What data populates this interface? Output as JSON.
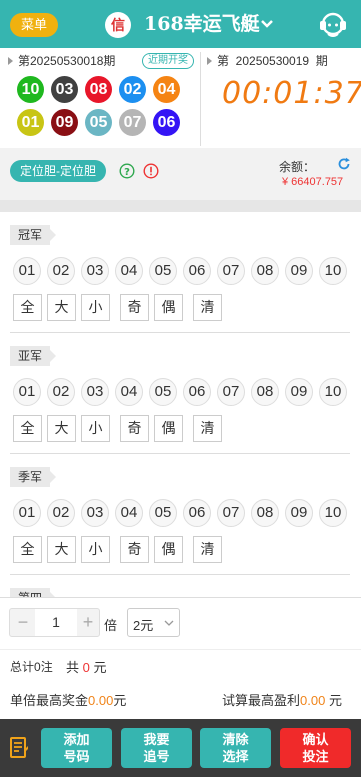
{
  "header": {
    "menu_label": "菜单",
    "badge_label": "信",
    "title": "168幸运飞艇"
  },
  "previous_draw": {
    "issue_label": "第20250530018期",
    "history_label": "近期开奖",
    "balls": [
      {
        "number": "10",
        "color": "#1fb81f"
      },
      {
        "number": "03",
        "color": "#404040"
      },
      {
        "number": "08",
        "color": "#e8162a"
      },
      {
        "number": "02",
        "color": "#1c8ff0"
      },
      {
        "number": "04",
        "color": "#f58413"
      },
      {
        "number": "01",
        "color": "#c8c515"
      },
      {
        "number": "09",
        "color": "#8a0f14"
      },
      {
        "number": "05",
        "color": "#6bb6c4"
      },
      {
        "number": "07",
        "color": "#b5b5b5"
      },
      {
        "number": "06",
        "color": "#3414f5"
      }
    ]
  },
  "current_draw": {
    "issue_label": "第  20250530019  期",
    "countdown": "00:01:37"
  },
  "mode": {
    "play_mode": "定位胆-定位胆",
    "balance_label": "余额：",
    "balance_value": "¥ 66407.757"
  },
  "sections": [
    {
      "position": "冠军"
    },
    {
      "position": "亚军"
    },
    {
      "position": "季军"
    },
    {
      "position": "第四"
    }
  ],
  "numbers": [
    "01",
    "02",
    "03",
    "04",
    "05",
    "06",
    "07",
    "08",
    "09",
    "10"
  ],
  "quick_options": [
    "全",
    "大",
    "小",
    "奇",
    "偶",
    "清"
  ],
  "multiplier": {
    "value": "1",
    "label": "倍",
    "unit": "2元"
  },
  "totals": {
    "count_prefix": "总计",
    "count_value": "0",
    "count_suffix": "注",
    "total_prefix": "共",
    "total_value": "0",
    "total_suffix": "元",
    "max_prize_label": "单倍最高奖金",
    "max_prize_value": "0.00",
    "max_prize_unit": "元",
    "max_profit_label": "试算最高盈利",
    "max_profit_value": "0.00",
    "max_profit_unit": "元"
  },
  "actions": {
    "add_line1": "添加",
    "add_line2": "号码",
    "chase_line1": "我要",
    "chase_line2": "追号",
    "clear_line1": "清除",
    "clear_line2": "选择",
    "confirm_line1": "确认",
    "confirm_line2": "投注"
  },
  "icons": [
    "chevron-down-icon",
    "customer-service-icon",
    "help-icon",
    "warning-icon",
    "refresh-icon",
    "note-icon"
  ],
  "colors": {
    "primary": "#36b5b0",
    "menu": "#f0b10f",
    "countdown": "#f07a12",
    "confirm": "#f02a2a"
  }
}
